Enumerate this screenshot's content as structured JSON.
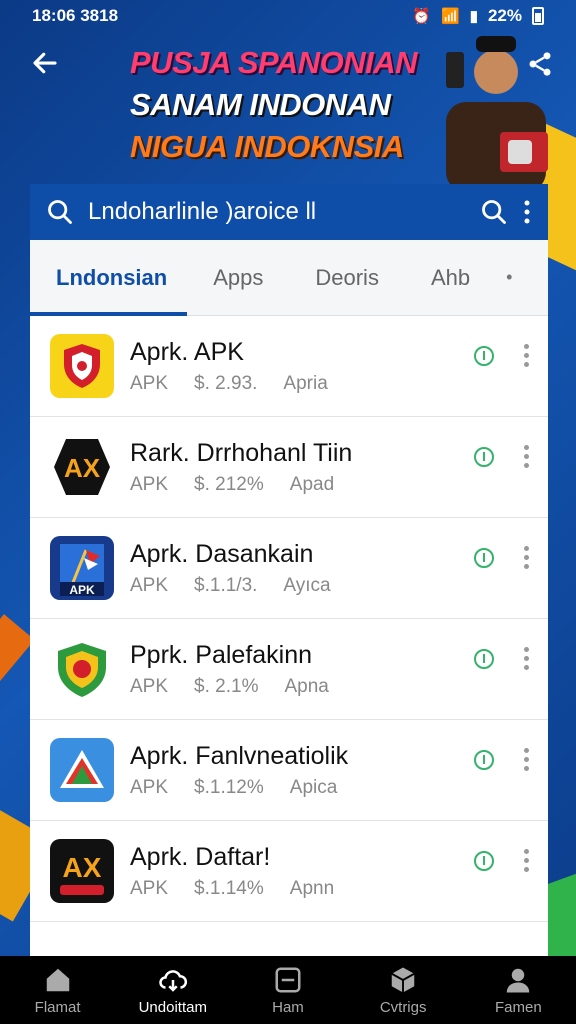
{
  "status": {
    "time": "18:06 3818",
    "battery": "22%"
  },
  "banner": {
    "line1": "PUSJA SPANONIAN",
    "line2": "SANAM INDONAN",
    "line3": "NIGUA INDOKNSIA"
  },
  "search": {
    "query": "Lndoharlinle )aroice ll"
  },
  "tabs": [
    {
      "label": "Lndonsian"
    },
    {
      "label": "Apps"
    },
    {
      "label": "Deoris"
    },
    {
      "label": "Ahb"
    }
  ],
  "tabs_more": "•",
  "apps": [
    {
      "name": "Aprk. APK",
      "type": "APK",
      "size": "$. 2.93.",
      "extra": "Apria"
    },
    {
      "name": "Rark. Drrhohanl Tiin",
      "type": "APK",
      "size": "$. 212%",
      "extra": "Apad"
    },
    {
      "name": "Aprk. Dasankain",
      "type": "APK",
      "size": "$.1.1/3.",
      "extra": "Ayıca"
    },
    {
      "name": "Pprk. Palefakinn",
      "type": "APK",
      "size": "$. 2.1%",
      "extra": "Apna"
    },
    {
      "name": "Aprk. Fanlvneatiolik",
      "type": "APK",
      "size": "$.1.12%",
      "extra": "Apica"
    },
    {
      "name": "Aprk. Daftar!",
      "type": "APK",
      "size": "$.1.14%",
      "extra": "Apnn"
    }
  ],
  "nav": [
    {
      "label": "Flamat"
    },
    {
      "label": "Undoittam"
    },
    {
      "label": "Ham"
    },
    {
      "label": "Cvtrigs"
    },
    {
      "label": "Famen"
    }
  ],
  "colors": {
    "primary": "#0f4ea8",
    "accent_green": "#34b36a",
    "banner_pink": "#ff3d6e",
    "banner_orange": "#ff7a1a"
  }
}
